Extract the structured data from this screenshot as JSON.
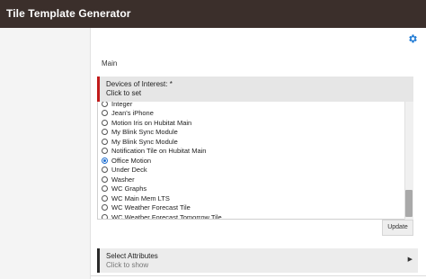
{
  "app": {
    "title": "Tile Template Generator"
  },
  "icons": {
    "settings": "gear-icon",
    "expand": "triangle-right-icon"
  },
  "colors": {
    "topbar": "#3b2f2b",
    "accent": "#1f7ad4",
    "required_marker": "#c21b1b"
  },
  "main": {
    "section_label": "Main",
    "devices": {
      "label": "Devices of Interest: *",
      "sublabel": "Click to set",
      "options": [
        {
          "label": "Integer",
          "selected": false
        },
        {
          "label": "Jean's iPhone",
          "selected": false
        },
        {
          "label": "Motion Iris on Hubitat Main",
          "selected": false
        },
        {
          "label": "My Blink Sync Module",
          "selected": false
        },
        {
          "label": "My Blink Sync Module",
          "selected": false
        },
        {
          "label": "Notification Tile on Hubitat Main",
          "selected": false
        },
        {
          "label": "Office Motion",
          "selected": true
        },
        {
          "label": "Under Deck",
          "selected": false
        },
        {
          "label": "Washer",
          "selected": false
        },
        {
          "label": "WC Graphs",
          "selected": false
        },
        {
          "label": "WC Main Mem LTS",
          "selected": false
        },
        {
          "label": "WC Weather Forecast Tile",
          "selected": false
        },
        {
          "label": "WC Weather Forecast Tomorrow Tile",
          "selected": false
        }
      ]
    },
    "update_label": "Update",
    "attributes": {
      "label": "Select Attributes",
      "sublabel": "Click to show"
    }
  }
}
